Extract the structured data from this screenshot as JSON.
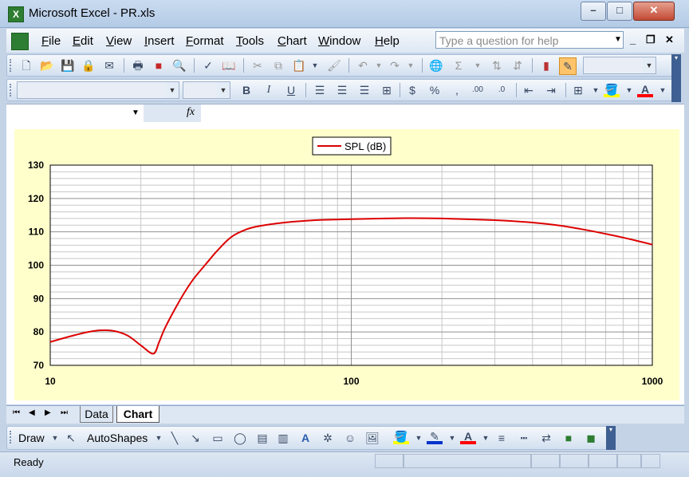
{
  "window": {
    "title": "Microsoft Excel - PR.xls",
    "icon_name": "excel-icon",
    "min_label": "–",
    "max_label": "□",
    "close_label": "✕"
  },
  "menu": {
    "items": [
      "File",
      "Edit",
      "View",
      "Insert",
      "Format",
      "Tools",
      "Chart",
      "Window",
      "Help"
    ],
    "help_placeholder": "Type a question for help"
  },
  "formula_bar": {
    "fx": "fx"
  },
  "sheets": {
    "tabs": [
      "Data",
      "Chart"
    ],
    "active": "Chart"
  },
  "draw_toolbar": {
    "draw_label": "Draw",
    "autoshapes_label": "AutoShapes"
  },
  "status": {
    "text": "Ready"
  },
  "colors": {
    "series": "#dd0000",
    "plot_background": "#ffffcc",
    "title_bar": "#b4cbe6"
  },
  "chart_data": {
    "type": "line",
    "x_scale": "log",
    "xlim": [
      10,
      1000
    ],
    "ylim": [
      70,
      130
    ],
    "x_ticks": [
      "10",
      "100",
      "1000"
    ],
    "y_ticks": [
      "70",
      "80",
      "90",
      "100",
      "110",
      "120",
      "130"
    ],
    "legend": "top-center",
    "grid": true,
    "series": [
      {
        "name": "SPL (dB)",
        "color": "#dd0000",
        "x": [
          10,
          12,
          14,
          16,
          18,
          20,
          22,
          23,
          24,
          26,
          28,
          30,
          33,
          36,
          40,
          45,
          50,
          60,
          70,
          80,
          100,
          150,
          200,
          300,
          400,
          500,
          600,
          700,
          800,
          900,
          1000
        ],
        "y": [
          77,
          79,
          80.3,
          80.4,
          79,
          76,
          73.5,
          77,
          81,
          87,
          92,
          96,
          100.5,
          104.5,
          108.5,
          110.8,
          111.8,
          112.8,
          113.3,
          113.6,
          113.8,
          114.1,
          114,
          113.5,
          112.8,
          111.8,
          110.6,
          109.4,
          108.3,
          107.2,
          106.2
        ]
      }
    ]
  }
}
